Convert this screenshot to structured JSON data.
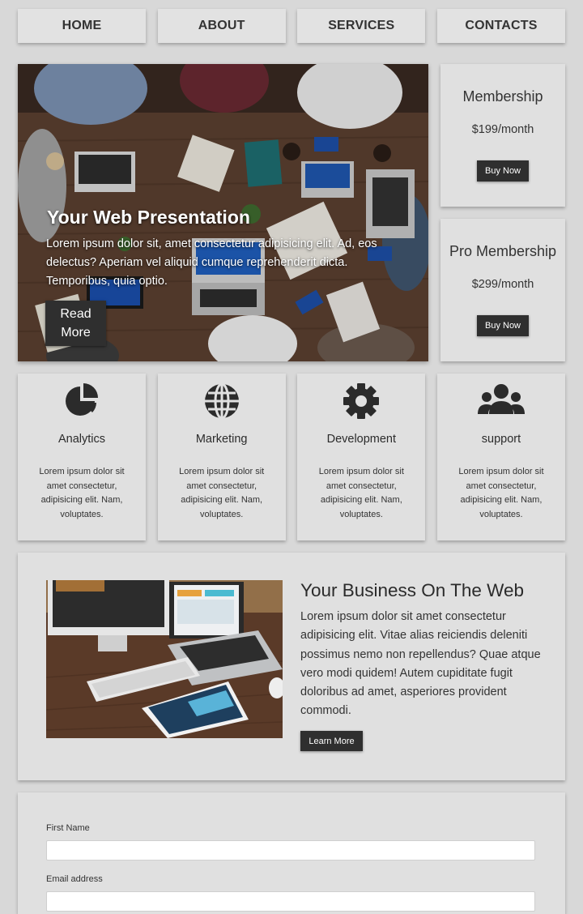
{
  "nav": {
    "items": [
      {
        "label": "HOME"
      },
      {
        "label": "ABOUT"
      },
      {
        "label": "SERVICES"
      },
      {
        "label": "CONTACTS"
      }
    ]
  },
  "hero": {
    "title": "Your Web Presentation",
    "text": "Lorem ipsum dolor sit, amet consectetur adipisicing elit. Ad, eos delectus? Aperiam vel aliquid cumque reprehenderit dicta. Temporibus, quia optio.",
    "button_label": "Read More"
  },
  "memberships": [
    {
      "title": "Membership",
      "price": "$199/month",
      "button_label": "Buy Now"
    },
    {
      "title": "Pro Membership",
      "price": "$299/month",
      "button_label": "Buy Now"
    }
  ],
  "features": [
    {
      "icon": "pie-chart-icon",
      "title": "Analytics",
      "text": "Lorem ipsum dolor sit amet consectetur, adipisicing elit. Nam, voluptates."
    },
    {
      "icon": "globe-icon",
      "title": "Marketing",
      "text": "Lorem ipsum dolor sit amet consectetur, adipisicing elit. Nam, voluptates."
    },
    {
      "icon": "gear-icon",
      "title": "Development",
      "text": "Lorem ipsum dolor sit amet consectetur, adipisicing elit. Nam, voluptates."
    },
    {
      "icon": "users-icon",
      "title": "support",
      "text": "Lorem ipsum dolor sit amet consectetur, adipisicing elit. Nam, voluptates."
    }
  ],
  "business": {
    "title": "Your Business On The Web",
    "text": "Lorem ipsum dolor sit amet consectetur adipisicing elit. Vitae alias reiciendis deleniti possimus nemo non repellendus? Quae atque vero modi quidem! Autem cupiditate fugit doloribus ad amet, asperiores provident commodi.",
    "button_label": "Learn More"
  },
  "form": {
    "first_name_label": "First Name",
    "first_name_value": "",
    "email_label": "Email address",
    "email_value": ""
  },
  "colors": {
    "page_background": "#d8d8d8",
    "panel_background": "#e0e0e0",
    "button_dark": "#2f2f2f",
    "icon_dark": "#2b2b2b"
  }
}
